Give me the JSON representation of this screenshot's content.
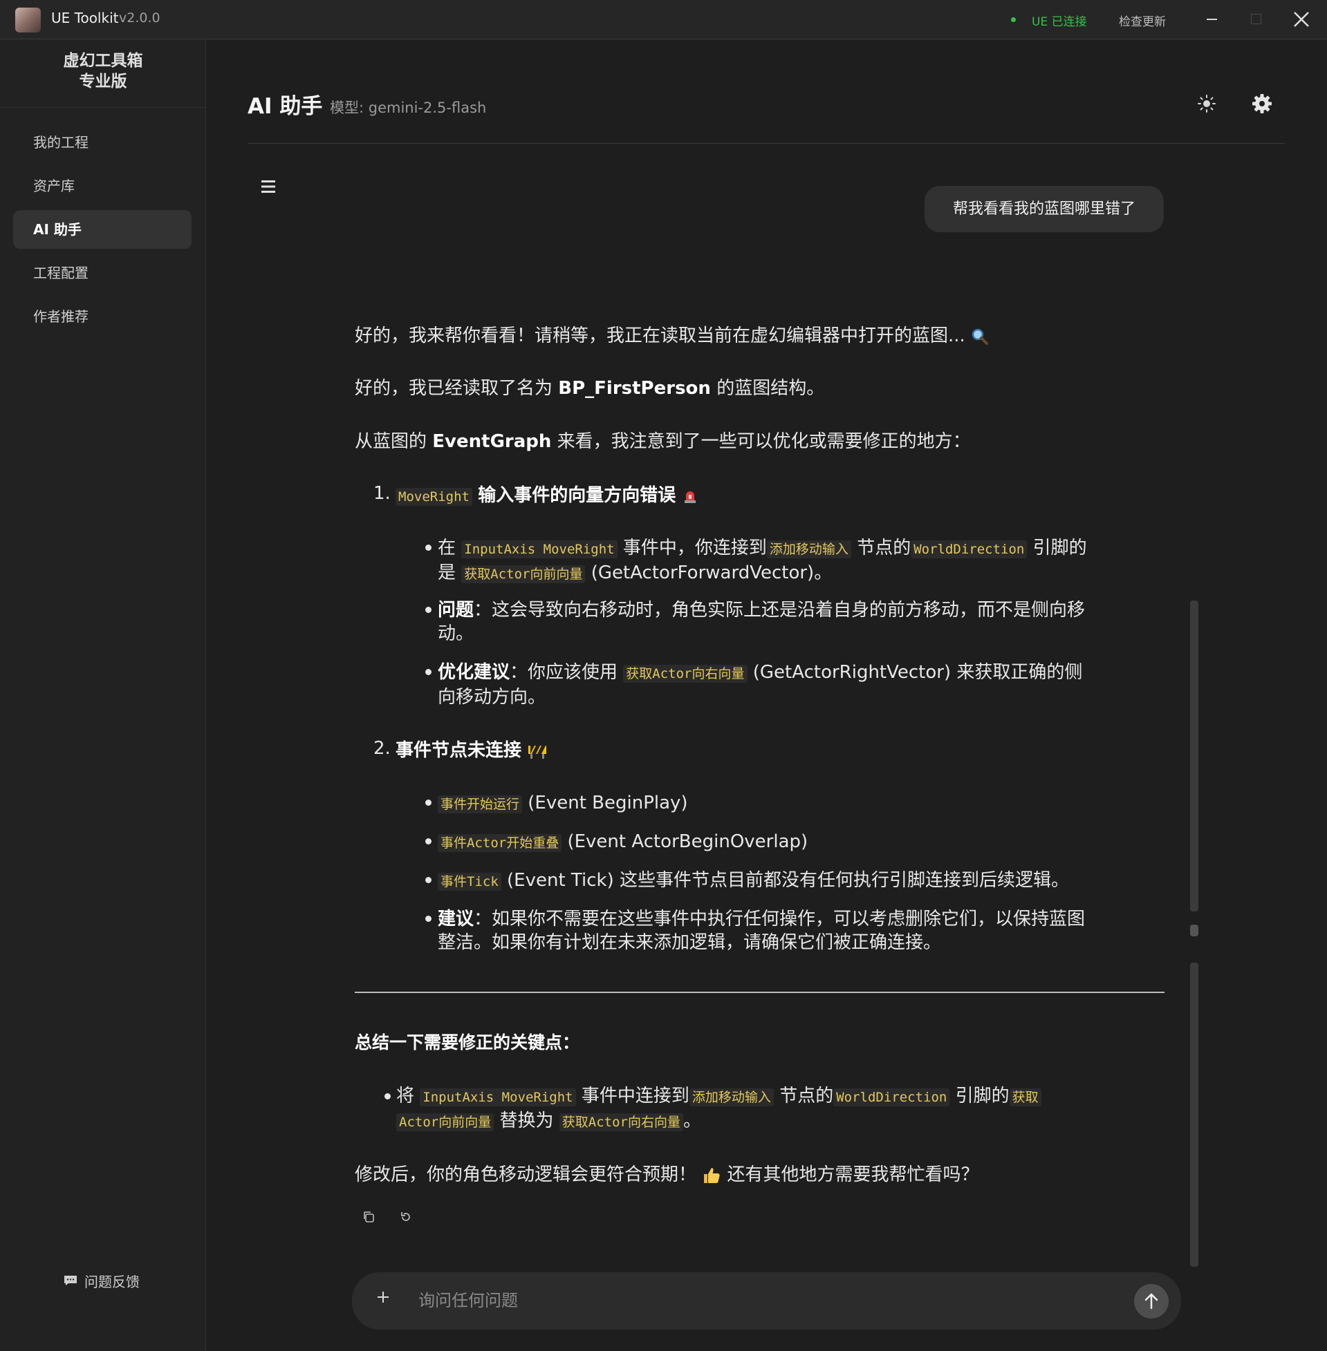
{
  "window": {
    "app_name": "UE Toolkit",
    "version": "v2.0.0",
    "status": "UE 已连接",
    "check_update": "检查更新"
  },
  "sidebar": {
    "brand_line1": "虚幻工具箱",
    "brand_line2": "专业版",
    "items": [
      {
        "label": "我的工程"
      },
      {
        "label": "资产库"
      },
      {
        "label": "AI 助手"
      },
      {
        "label": "工程配置"
      },
      {
        "label": "作者推荐"
      }
    ],
    "active_index": 2,
    "feedback": "问题反馈"
  },
  "header": {
    "title": "AI 助手",
    "model_label": "模型: gemini-2.5-flash"
  },
  "chat": {
    "user_message": "帮我看看我的蓝图哪里错了",
    "assistant": {
      "p1": "好的，我来帮你看看！请稍等，我正在读取当前在虚幻编辑器中打开的蓝图...",
      "p2_a": "好的，我已经读取了名为",
      "p2_bold": "BP_FirstPerson",
      "p2_b": "的蓝图结构。",
      "p3_a": "从蓝图的",
      "p3_bold": "EventGraph",
      "p3_b": "来看，我注意到了一些可以优化或需要修正的地方：",
      "issue1": {
        "num": "1.",
        "code": "MoveRight",
        "title": "输入事件的向量方向错误",
        "b1_a": "在",
        "b1_code1": "InputAxis MoveRight",
        "b1_b": "事件中，你连接到",
        "b1_code2": "添加移动输入",
        "b1_c": "节点的",
        "b1_code3": "WorldDirection",
        "b1_d": "引脚的",
        "b1_e": "是",
        "b1_code4": "获取Actor向前向量",
        "b1_f": "(GetActorForwardVector)。",
        "b2_bold": "问题",
        "b2_text_a": "：这会导致向右移动时，角色实际上还是沿着自身的前方移动，而不是侧向移",
        "b2_text_b": "动。",
        "b3_bold": "优化建议",
        "b3_a": "：你应该使用",
        "b3_code": "获取Actor向右向量",
        "b3_b": "(GetActorRightVector) 来获取正确的侧",
        "b3_c": "向移动方向。"
      },
      "issue2": {
        "num": "2.",
        "title": "事件节点未连接",
        "b1_code": "事件开始运行",
        "b1_text": "(Event BeginPlay)",
        "b2_code": "事件Actor开始重叠",
        "b2_text": "(Event ActorBeginOverlap)",
        "b3_code": "事件Tick",
        "b3_text": "(Event Tick) 这些事件节点目前都没有任何执行引脚连接到后续逻辑。",
        "b4_bold": "建议",
        "b4_a": "：如果你不需要在这些事件中执行任何操作，可以考虑删除它们，以保持蓝图",
        "b4_b": "整洁。如果你有计划在未来添加逻辑，请确保它们被正确连接。"
      },
      "summary_title": "总结一下需要修正的关键点：",
      "summary": {
        "a": "将",
        "code1": "InputAxis MoveRight",
        "b": "事件中连接到",
        "code2": "添加移动输入",
        "c": "节点的",
        "code3": "WorldDirection",
        "d": "引脚的",
        "code4a": "获取",
        "code4b": "Actor向前向量",
        "e": "替换为",
        "code5": "获取Actor向右向量",
        "f": "。"
      },
      "closing_a": "修改后，你的角色移动逻辑会更符合预期！",
      "closing_b": "还有其他地方需要我帮忙看吗？"
    }
  },
  "input": {
    "placeholder": "询问任何问题",
    "value": ""
  },
  "icons": [
    "menu-icon",
    "sun-icon",
    "gear-icon",
    "magnifier-icon",
    "siren-icon",
    "construction-icon",
    "thumbs-up-icon",
    "copy-icon",
    "regenerate-icon",
    "plus-icon",
    "send-icon",
    "chat-icon"
  ],
  "colors": {
    "background": "#1e1e1e",
    "sidebar": "#222222",
    "status_green": "#35c24a",
    "code_text": "#e3c85a",
    "code_bg": "#2b2b2b"
  }
}
